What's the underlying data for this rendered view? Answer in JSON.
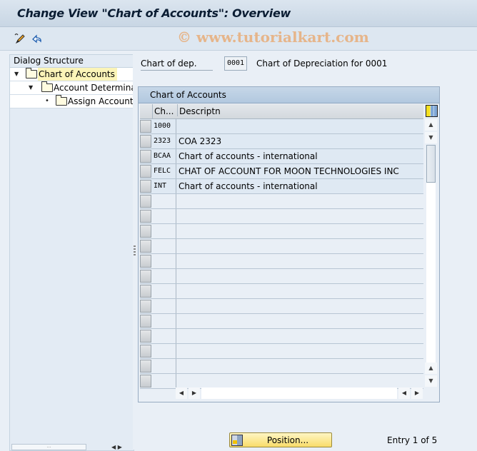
{
  "window": {
    "title": "Change View \"Chart of Accounts\": Overview"
  },
  "toolbar": {
    "watermark": "© www.tutorialkart.com",
    "icons": [
      "display-change-icon",
      "undo-icon"
    ]
  },
  "dialog_structure": {
    "header": "Dialog Structure",
    "items": [
      {
        "label": "Chart of Accounts",
        "level": 0,
        "expanded": true,
        "selected": true
      },
      {
        "label": "Account Determinati",
        "level": 1,
        "expanded": true,
        "selected": false
      },
      {
        "label": "Assign Accounts",
        "level": 2,
        "expanded": false,
        "selected": false
      }
    ],
    "hscroll_grip": "..."
  },
  "filter": {
    "label": "Chart of dep.",
    "value": "0001",
    "description": "Chart of Depreciation for 0001"
  },
  "table": {
    "title": "Chart of Accounts",
    "columns": [
      "Ch...",
      "Descriptn"
    ],
    "rows": [
      {
        "code": "1000",
        "description": ""
      },
      {
        "code": "2323",
        "description": "COA 2323"
      },
      {
        "code": "BCAA",
        "description": "Chart of accounts - international"
      },
      {
        "code": "FELC",
        "description": "CHAT OF ACCOUNT FOR MOON TECHNOLOGIES INC"
      },
      {
        "code": "INT",
        "description": "Chart of accounts - international"
      }
    ],
    "empty_rows": 13
  },
  "footer": {
    "position_button": "Position...",
    "entry_info": "Entry 1 of 5"
  }
}
